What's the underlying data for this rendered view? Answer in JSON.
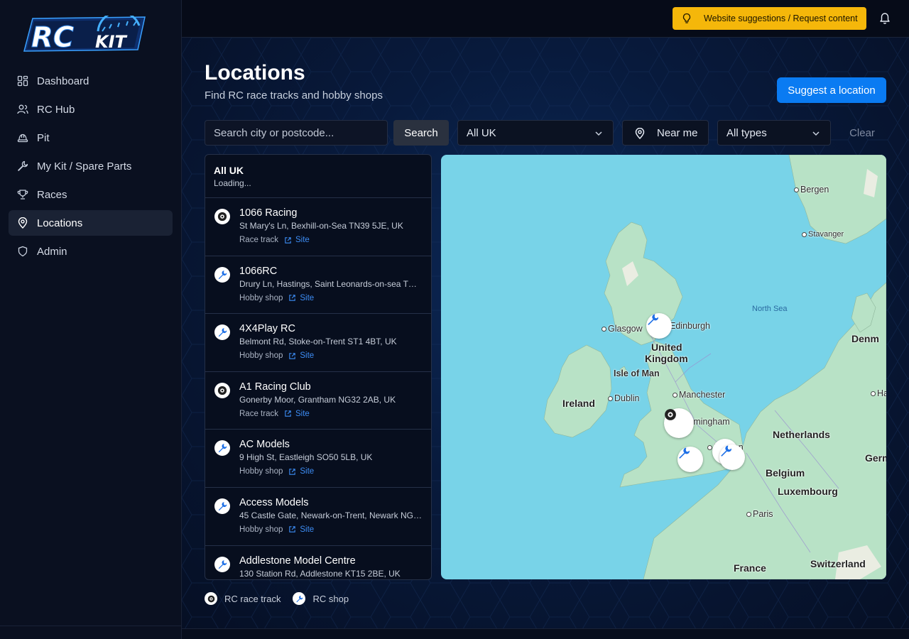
{
  "brand": {
    "logo_text": "RC KIT"
  },
  "sidebar": {
    "items": [
      {
        "label": "Dashboard",
        "icon": "dashboard-icon"
      },
      {
        "label": "RC Hub",
        "icon": "users-icon"
      },
      {
        "label": "Pit",
        "icon": "hard-hat-icon"
      },
      {
        "label": "My Kit / Spare Parts",
        "icon": "wrench-icon"
      },
      {
        "label": "Races",
        "icon": "trophy-icon"
      },
      {
        "label": "Locations",
        "icon": "map-pin-icon",
        "active": true
      },
      {
        "label": "Admin",
        "icon": "shield-icon"
      }
    ]
  },
  "topbar": {
    "banner_label": "Website suggestions / Request content",
    "banner_color": "#f5b70a"
  },
  "page": {
    "title": "Locations",
    "subtitle": "Find RC race tracks and hobby shops",
    "suggest_button": "Suggest a location"
  },
  "filters": {
    "search_placeholder": "Search city or postcode...",
    "search_value": "",
    "search_button": "Search",
    "region_selected": "All UK",
    "near_me_label": "Near me",
    "type_selected": "All types",
    "clear_label": "Clear"
  },
  "list": {
    "header_title": "All UK",
    "header_status": "Loading...",
    "items": [
      {
        "name": "1066 Racing",
        "address": "St Mary's Ln, Bexhill-on-Sea TN39 5JE, UK",
        "type": "Race track",
        "link": "Site",
        "kind": "track"
      },
      {
        "name": "1066RC",
        "address": "Drury Ln, Hastings, Saint Leonards-on-sea TN38 9BJ, UK",
        "type": "Hobby shop",
        "link": "Site",
        "kind": "shop"
      },
      {
        "name": "4X4Play RC",
        "address": "Belmont Rd, Stoke-on-Trent ST1 4BT, UK",
        "type": "Hobby shop",
        "link": "Site",
        "kind": "shop"
      },
      {
        "name": "A1 Racing Club",
        "address": "Gonerby Moor, Grantham NG32 2AB, UK",
        "type": "Race track",
        "link": "Site",
        "kind": "track"
      },
      {
        "name": "AC Models",
        "address": "9 High St, Eastleigh SO50 5LB, UK",
        "type": "Hobby shop",
        "link": "Site",
        "kind": "shop"
      },
      {
        "name": "Access Models",
        "address": "45 Castle Gate, Newark-on-Trent, Newark NG24 1BE, UK",
        "type": "Hobby shop",
        "link": "Site",
        "kind": "shop"
      },
      {
        "name": "Addlestone Model Centre",
        "address": "130 Station Rd, Addlestone KT15 2BE, UK",
        "type": "Hobby shop",
        "link": "Site",
        "kind": "shop"
      }
    ]
  },
  "map": {
    "labels": {
      "bergen": "Bergen",
      "stavanger": "Stavanger",
      "north_sea": "North Sea",
      "glasgow": "Glasgow",
      "edinburgh": "Edinburgh",
      "united": "United",
      "kingdom": "Kingdom",
      "isle_of_man": "Isle of Man",
      "ireland": "Ireland",
      "dublin": "Dublin",
      "manchester": "Manchester",
      "birmingham": "Birmingham",
      "london": "London",
      "netherlands": "Netherlands",
      "belgium": "Belgium",
      "luxembourg": "Luxembourg",
      "paris": "Paris",
      "france": "France",
      "switzerland": "Switzerland",
      "denmark": "Denm",
      "germany": "Germ",
      "hamburg": "Ha"
    },
    "water_color": "#78d3e8",
    "land_color": "#b6e3c5"
  },
  "legend": {
    "track_label": "RC race track",
    "shop_label": "RC shop"
  },
  "colors": {
    "accent": "#0a7bf2",
    "link": "#3d8df5"
  }
}
